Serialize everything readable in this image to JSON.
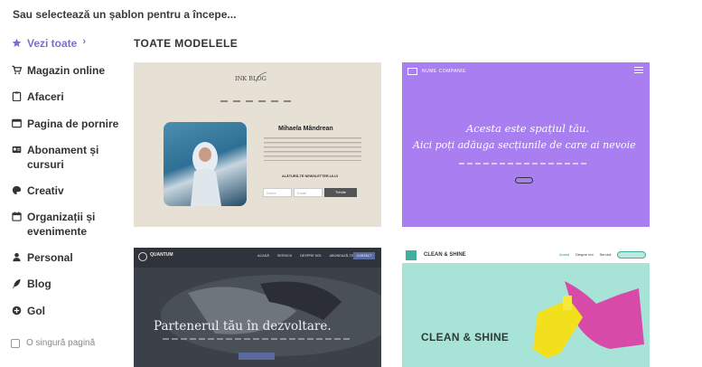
{
  "header": {
    "prompt": "Sau selectează un șablon pentru a începe..."
  },
  "sidebar": {
    "items": [
      {
        "label": "Vezi toate",
        "icon": "star-icon",
        "active": true
      },
      {
        "label": "Magazin online",
        "icon": "cart-icon"
      },
      {
        "label": "Afaceri",
        "icon": "clipboard-icon"
      },
      {
        "label": "Pagina de pornire",
        "icon": "browser-window-icon"
      },
      {
        "label": "Abonament și cursuri",
        "icon": "id-card-icon"
      },
      {
        "label": "Creativ",
        "icon": "palette-icon"
      },
      {
        "label": "Organizații și evenimente",
        "icon": "calendar-icon"
      },
      {
        "label": "Personal",
        "icon": "person-icon"
      },
      {
        "label": "Blog",
        "icon": "feather-icon"
      },
      {
        "label": "Gol",
        "icon": "plus-circle-icon"
      }
    ],
    "checkbox_label": "O singură pagină",
    "active_color": "#7b6fc9"
  },
  "main": {
    "section_title": "TOATE MODELELE",
    "templates": [
      {
        "logo": "INK BLOG",
        "author": "Mihaela Mândrean",
        "cta": "ALĂTURĂ-TE NEWSLETTER-ULUI",
        "submit": "Trimite",
        "field_name": "Nume",
        "field_email": "Email"
      },
      {
        "brand": "NUME COMPANIE",
        "headline": "Acesta este spațiul tău.",
        "subheadline": "Aici poți adăuga secțiunile de care ai nevoie"
      },
      {
        "brand": "QUANTUM",
        "nav": [
          "ACASĂ",
          "SERVICII",
          "DESPRE NOI",
          "ABONEAZĂ-TE"
        ],
        "contact": "CONTACT",
        "headline": "Partenerul tău în dezvoltare."
      },
      {
        "brand": "CLEAN & SHINE",
        "nav": [
          "Acasă",
          "Despre noi",
          "Servicii"
        ],
        "headline": "CLEAN & SHINE"
      }
    ]
  }
}
